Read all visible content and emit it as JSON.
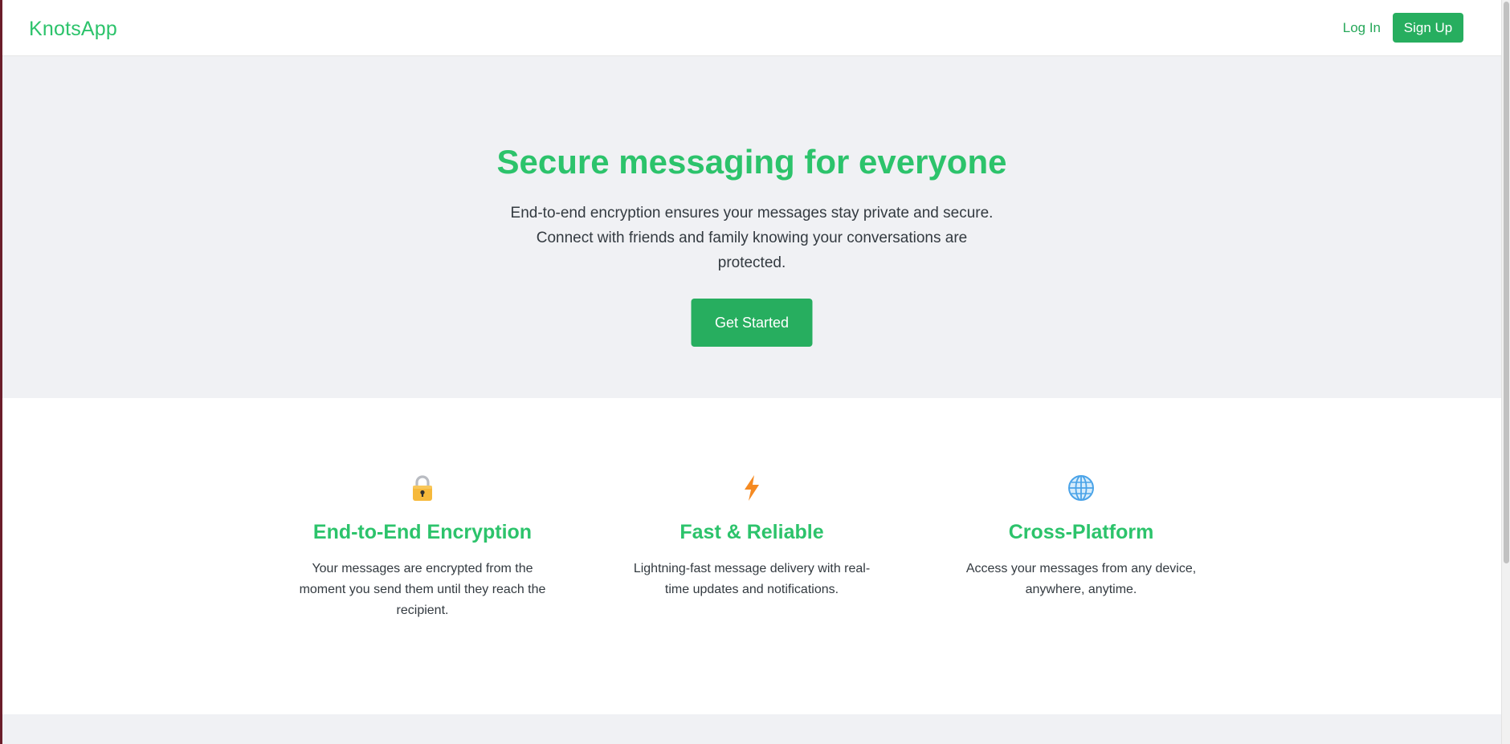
{
  "header": {
    "brand": "KnotsApp",
    "login_label": "Log In",
    "signup_label": "Sign Up"
  },
  "hero": {
    "title": "Secure messaging for everyone",
    "subtitle": "End-to-end encryption ensures your messages stay private and secure. Connect with friends and family knowing your conversations are protected.",
    "cta_label": "Get Started"
  },
  "features": [
    {
      "icon": "lock-icon",
      "title": "End-to-End Encryption",
      "description": "Your messages are encrypted from the moment you send them until they reach the recipient."
    },
    {
      "icon": "lightning-icon",
      "title": "Fast & Reliable",
      "description": "Lightning-fast message delivery with real-time updates and notifications."
    },
    {
      "icon": "globe-icon",
      "title": "Cross-Platform",
      "description": "Access your messages from any device, anywhere, anytime."
    }
  ],
  "colors": {
    "brand_green": "#2cc36b",
    "button_green": "#27ae5f",
    "hero_background": "#f0f1f4",
    "body_text": "#333a40"
  }
}
